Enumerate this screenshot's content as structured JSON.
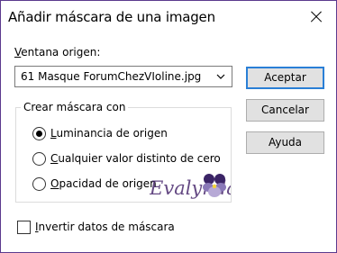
{
  "window": {
    "title": "Añadir máscara de una imagen",
    "close_icon": "close-icon"
  },
  "source": {
    "label_accel": "V",
    "label_rest": "entana origen:",
    "value": "61 Masque ForumChezVIoline.jpg",
    "arrow_icon": "chevron-down-icon"
  },
  "buttons": {
    "accept": "Aceptar",
    "cancel": "Cancelar",
    "help": "Ayuda"
  },
  "group": {
    "caption": "Crear máscara con",
    "options": [
      {
        "accel": "L",
        "rest": "uminancia de origen",
        "checked": true
      },
      {
        "accel": "C",
        "rest": "ualquier valor distinto de cero",
        "checked": false
      },
      {
        "accel": "O",
        "rest": "pacidad de origen",
        "checked": false
      }
    ]
  },
  "invert": {
    "accel": "I",
    "rest": "nvertir datos de máscara",
    "checked": false
  },
  "watermark": {
    "text": "Evalynda",
    "icon": "pansy-flower-icon"
  },
  "colors": {
    "border": "#5b3a8e",
    "button_face": "#e1e1e1",
    "default_button_border": "#2a7fd6",
    "watermark": "#4a2a6e"
  }
}
